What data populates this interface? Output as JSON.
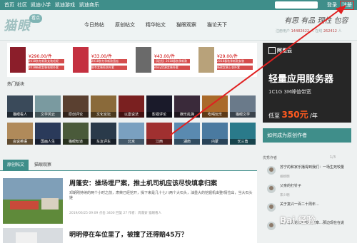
{
  "topnav": {
    "links": [
      "首页",
      "社区",
      "凯迪小学",
      "凯迪游戏",
      "凯迪商乐"
    ],
    "login": "登录",
    "register": "注册"
  },
  "header": {
    "logo_text": "猫眼",
    "logo_badge": "看点",
    "tabs": [
      "今日热帖",
      "原创帖文",
      "精华帖文",
      "猫眼观察",
      "猫论天下"
    ],
    "slogan": "有思 有品 理性 包容",
    "reg_info_prefix": "注册用户",
    "reg_users": "14482622",
    "reg_info_mid": "人 在线",
    "online_users": "262412",
    "reg_info_suffix": "人"
  },
  "ads": [
    {
      "price": "¥290.00/件",
      "tag1": "2018秋冬新款女装毛呢",
      "tag2": "2018新款女装毛呢外套",
      "color": "#8b1e2a"
    },
    {
      "price": "¥33.00/件",
      "tag1": "2018秋冬季新款宽松",
      "tag2": "秋冬女装毛衣外套",
      "color": "#c43040"
    },
    {
      "price": "¥43.00/件",
      "tag1": "【现货】2018春秋季新款",
      "tag2": "ebay货源女装外套",
      "color": "#6a6a6a"
    },
    {
      "price": "¥29.00/件",
      "tag1": "2018春秋季新款女装",
      "tag2": "新款女装上衣外套",
      "color": "#b8a27a"
    }
  ],
  "cloud_ad": {
    "brand": "阿里云",
    "headline": "轻量应用服务器",
    "spec": "1C1G 3M峰值带宽",
    "price_prefix": "低至",
    "price": "350元",
    "price_suffix": "/年"
  },
  "become_author": "如何成为原创作者",
  "hot": {
    "title": "热门版块",
    "items": [
      {
        "label": "猫眼看人",
        "color": "#3a4a5a"
      },
      {
        "label": "文学风云",
        "color": "#7a9aa0"
      },
      {
        "label": "原创评论",
        "color": "#5a4030"
      },
      {
        "label": "文化论坛",
        "color": "#8a6a3a"
      },
      {
        "label": "以案说法",
        "color": "#7a2020"
      },
      {
        "label": "影视评论",
        "color": "#1a1a2a"
      },
      {
        "label": "娱乐乱弹",
        "color": "#3a2a3a"
      },
      {
        "label": "吃喝玩乐",
        "color": "#aa6a2a"
      },
      {
        "label": "猫眼文学",
        "color": "#6a7a8a"
      },
      {
        "label": "会说英语",
        "color": "#b08a5a"
      },
      {
        "label": "国画人生",
        "color": "#2a3a5a"
      },
      {
        "label": "猫眼知道",
        "color": "#4a5a3a"
      },
      {
        "label": "车友评车",
        "color": "#2a3a4a"
      },
      {
        "label": "北京",
        "color": "#7aa0c0"
      },
      {
        "label": "江西",
        "color": "#a03030"
      },
      {
        "label": "湖南",
        "color": "#5a8ab0"
      },
      {
        "label": "内蒙",
        "color": "#4a7aa0"
      },
      {
        "label": "长三角",
        "color": "#2a7a8a"
      }
    ]
  },
  "article_tabs": {
    "original": "原创帖文",
    "observe": "猫眼观察"
  },
  "articles": [
    {
      "title": "周蓬安：操场埋尸案，推土机司机应该尽快填拿归案",
      "excerpt": "邓朝刚持续的两个小时之前，肃荣已经挖开，操下来是几十七八两个大石头，油墨大的挖掘机由整I情拉出，当大石头搓",
      "meta": "2019/06/25 09:09    点击 3400   回复 27   作者：周蓬安    猫眼看人"
    },
    {
      "title": "明明停在车位里了，被撞了还得赔45万？",
      "excerpt": "",
      "meta": ""
    }
  ],
  "authors": {
    "title": "优秀作者",
    "pager": "1/3",
    "items": [
      {
        "desc": "苏宁的和家乐播得到我们：一场生死较量",
        "name": "胡扬明"
      },
      {
        "desc": "父亲的打针子",
        "name": "宋少明"
      },
      {
        "desc": "关于复兴一百二十周年…",
        "name": ""
      },
      {
        "desc": "关于写评论和新知识文章…那边现在在说",
        "name": ""
      }
    ]
  },
  "watermark": "Bai 经验",
  "colors": {
    "primary": "#3f8e8a",
    "arrow": "#e02020",
    "price": "#ff5a1f"
  }
}
